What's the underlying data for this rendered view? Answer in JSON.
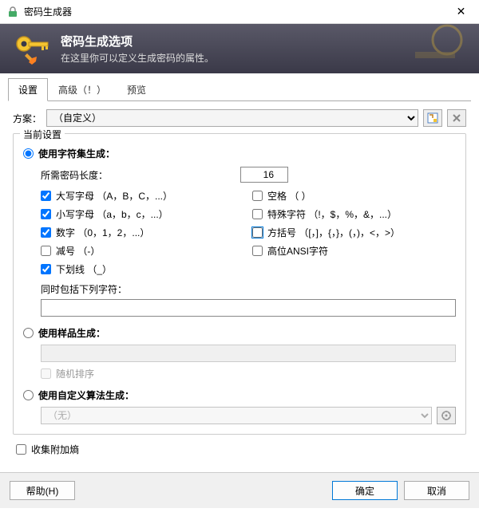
{
  "window": {
    "title": "密码生成器"
  },
  "header": {
    "title": "密码生成选项",
    "subtitle": "在这里你可以定义生成密码的属性。"
  },
  "tabs": {
    "settings": "设置",
    "advanced": "高级（！）",
    "preview": "预览"
  },
  "scheme": {
    "label": "方案：",
    "value": "（自定义）"
  },
  "fieldset": {
    "legend": "当前设置",
    "charset_mode": "使用字符集生成：",
    "length_label": "所需密码长度：",
    "length_value": 16,
    "upper": "大写字母 （A，B，C，...）",
    "lower": "小写字母 （a，b，c，...）",
    "digits": "数字 （0，1，2，...）",
    "minus": "减号 （-）",
    "underscore": "下划线 （_）",
    "space": "空格 （ ）",
    "special": "特殊字符 （!，$，%，&，...）",
    "brackets": "方括号 （[，]，{，}，(，)，<，>）",
    "highansi": "高位ANSI字符",
    "include_label": "同时包括下列字符：",
    "pattern_mode": "使用样品生成：",
    "random_perm": "随机排序",
    "algo_mode": "使用自定义算法生成：",
    "algo_none": "（无）",
    "collect": "收集附加熵"
  },
  "footer": {
    "help": "帮助(H)",
    "ok": "确定",
    "cancel": "取消"
  }
}
